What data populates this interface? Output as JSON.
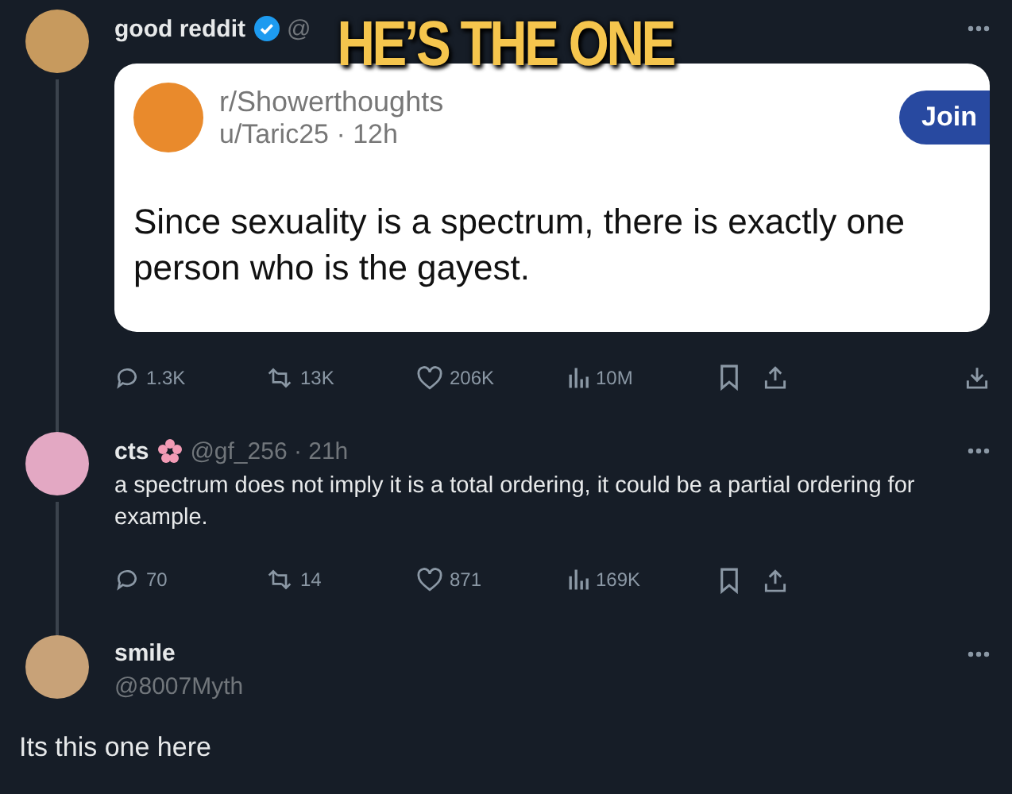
{
  "caption": "HE’S THE ONE",
  "posts": [
    {
      "name": "good reddit",
      "verified": true,
      "handle": "@",
      "thread_line": true,
      "embed": {
        "subreddit": "r/Showerthoughts",
        "meta": "u/Taric25 · 12h",
        "join": "Join",
        "title": "Since sexuality is a spectrum, there is exactly one person who is the gayest."
      },
      "actions": [
        {
          "kind": "reply",
          "count": "1.3K"
        },
        {
          "kind": "repost",
          "count": "13K"
        },
        {
          "kind": "like",
          "count": "206K"
        },
        {
          "kind": "views",
          "count": "10M"
        },
        {
          "kind": "bookmark"
        },
        {
          "kind": "share"
        },
        {
          "kind": "download"
        }
      ]
    },
    {
      "name": "cts",
      "flower": true,
      "handle": "@gf_256 · 21h",
      "thread_line": true,
      "text": "a spectrum does not imply it is a total ordering, it could be a partial ordering for example.",
      "actions": [
        {
          "kind": "reply",
          "count": "70"
        },
        {
          "kind": "repost",
          "count": "14"
        },
        {
          "kind": "like",
          "count": "871"
        },
        {
          "kind": "views",
          "count": "169K"
        },
        {
          "kind": "bookmark"
        },
        {
          "kind": "share"
        }
      ]
    },
    {
      "name": "smile",
      "handle": "@8007Myth",
      "thread_line": false,
      "body": "Its this one here"
    }
  ]
}
